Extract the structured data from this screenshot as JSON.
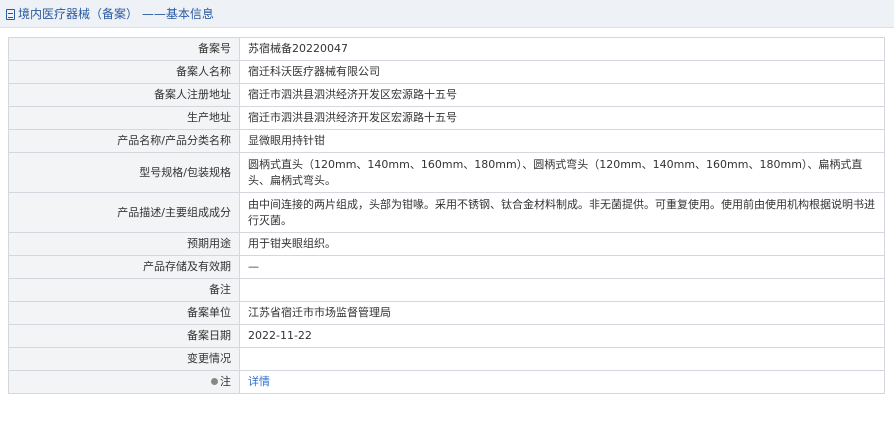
{
  "header": {
    "title": "境内医疗器械（备案） ——基本信息"
  },
  "rows": [
    {
      "label": "备案号",
      "value": "苏宿械备20220047"
    },
    {
      "label": "备案人名称",
      "value": "宿迁科沃医疗器械有限公司"
    },
    {
      "label": "备案人注册地址",
      "value": "宿迁市泗洪县泗洪经济开发区宏源路十五号"
    },
    {
      "label": "生产地址",
      "value": "宿迁市泗洪县泗洪经济开发区宏源路十五号"
    },
    {
      "label": "产品名称/产品分类名称",
      "value": "显微眼用持针钳"
    },
    {
      "label": "型号规格/包装规格",
      "value": "圆柄式直头（120mm、140mm、160mm、180mm）、圆柄式弯头（120mm、140mm、160mm、180mm）、扁柄式直头、扁柄式弯头。"
    },
    {
      "label": "产品描述/主要组成成分",
      "value": "由中间连接的两片组成，头部为钳喙。采用不锈钢、钛合金材料制成。非无菌提供。可重复使用。使用前由使用机构根据说明书进行灭菌。"
    },
    {
      "label": "预期用途",
      "value": "用于钳夹眼组织。"
    },
    {
      "label": "产品存储及有效期",
      "value": "—"
    },
    {
      "label": "备注",
      "value": ""
    },
    {
      "label": "备案单位",
      "value": "江苏省宿迁市市场监督管理局"
    },
    {
      "label": "备案日期",
      "value": "2022-11-22"
    },
    {
      "label": "变更情况",
      "value": ""
    }
  ],
  "note_row": {
    "label": "注",
    "link": "详情",
    "icon": "pin-icon"
  }
}
